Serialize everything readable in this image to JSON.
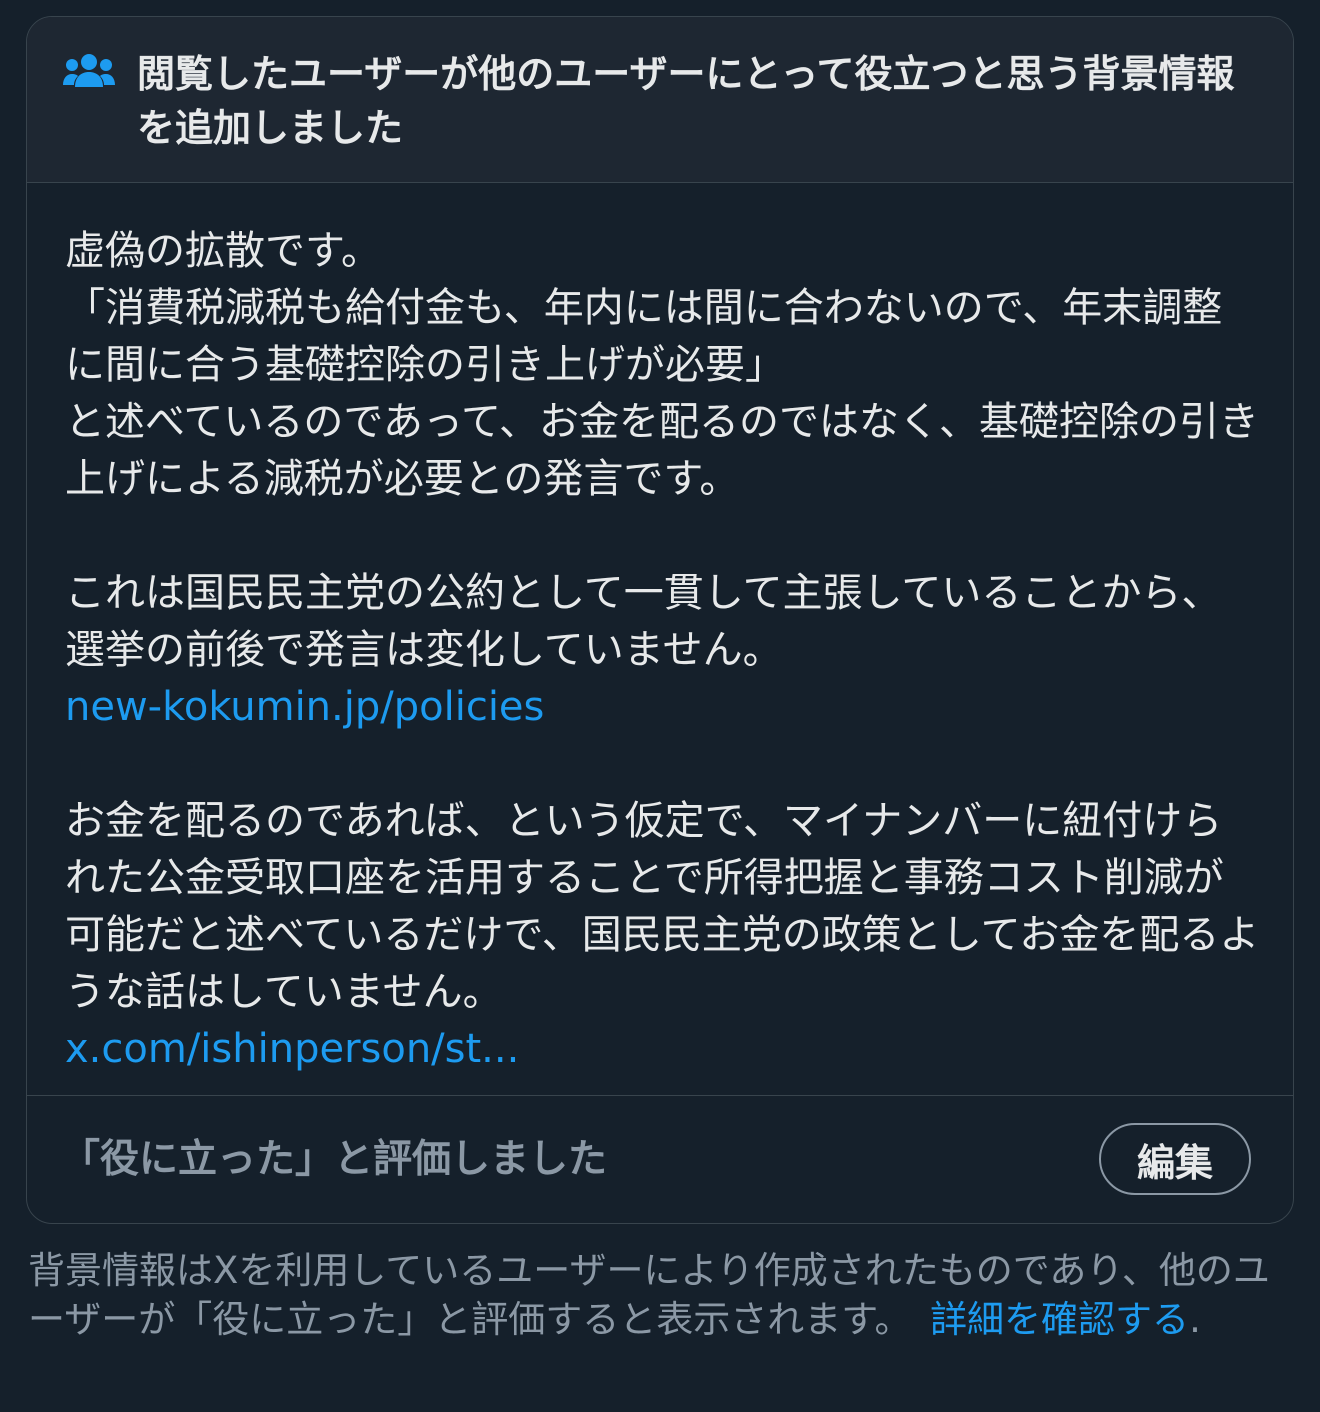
{
  "header": {
    "icon": "people-icon",
    "title": "閲覧したユーザーが他のユーザーにとって役立つと思う背景情報を追加しました"
  },
  "note": {
    "paragraphs": [
      "虚偽の拡散です。",
      "「消費税減税も給付金も、年内には間に合わないので、年末調整に間に合う基礎控除の引き上げが必要」",
      "と述べているのであって、お金を配るのではなく、基礎控除の引き上げによる減税が必要との発言です。",
      "これは国民民主党の公約として一貫して主張していることから、選挙の前後で発言は変化していません。",
      "お金を配るのであれば、という仮定で、マイナンバーに紐付けられた公金受取口座を活用することで所得把握と事務コスト削減が可能だと述べているだけで、国民民主党の政策としてお金を配るような話はしていません。"
    ],
    "links": [
      "new-kokumin.jp/policies",
      "x.com/ishinperson/st..."
    ]
  },
  "footer": {
    "rated_text": "「役に立った」と評価しました",
    "edit_label": "編集"
  },
  "disclaimer": {
    "text": "背景情報はXを利用しているユーザーにより作成されたものであり、他のユーザーが「役に立った」と評価すると表示されます。",
    "link_text": "詳細を確認する",
    "suffix": "."
  },
  "colors": {
    "background": "#15202b",
    "header_background": "#1e2732",
    "border": "#38444d",
    "text_primary": "#e7e9ea",
    "text_secondary": "#8b98a5",
    "accent": "#1d9bf0"
  }
}
